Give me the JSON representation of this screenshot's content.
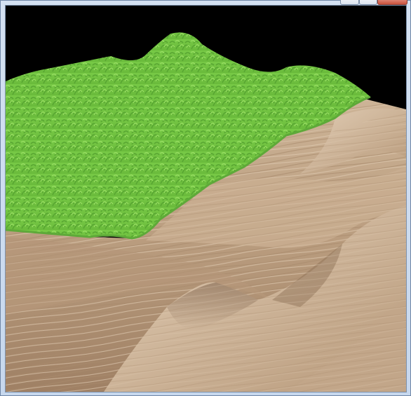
{
  "window": {
    "title": "",
    "buttons": [
      "minimize-button",
      "maximize-button",
      "close-button"
    ]
  },
  "scene": {
    "description_icons": [
      "grass-terrain",
      "wood-terrain"
    ],
    "colors": {
      "sky": "#000000",
      "grass_light": "#8fe25a",
      "grass_dark": "#5aa834",
      "wood_light": "#d7c0a4",
      "wood_dark": "#8f7258",
      "frame": "#c9d8ec"
    }
  }
}
